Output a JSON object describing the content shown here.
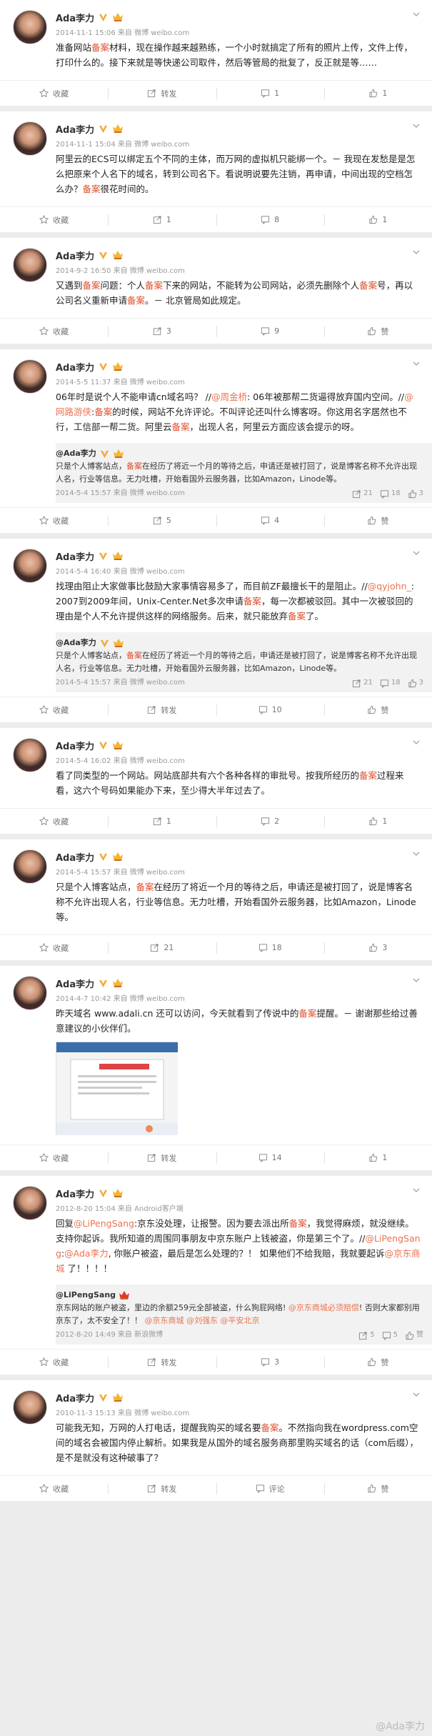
{
  "user": {
    "name": "Ada李力"
  },
  "watermark": "@Ada李力",
  "posts": [
    {
      "meta": "2014-11-1 15:06 来自 微博 weibo.com",
      "segments": [
        {
          "t": "准备网站"
        },
        {
          "t": "备案",
          "c": "kw"
        },
        {
          "t": "材料，现在操作越来越熟练，一个小时就搞定了所有的照片上传，文件上传，打印什么的。接下来就是等快递公司取件，然后等管局的批复了，反正就是等……"
        }
      ],
      "actions": [
        "收藏",
        "转发",
        "1",
        "1"
      ]
    },
    {
      "meta": "2014-11-1 15:04 来自 微博 weibo.com",
      "segments": [
        {
          "t": "阿里云的ECS可以绑定五个不同的主体，而万网的虚拟机只能绑一个。－ 我现在发愁是是怎么把原来个人名下的域名，转到公司名下。看说明说要先注销，再申请，中间出现的空档怎么办？"
        },
        {
          "t": "备案",
          "c": "kw"
        },
        {
          "t": "很花时间的。"
        }
      ],
      "actions": [
        "收藏",
        "1",
        "8",
        "1"
      ]
    },
    {
      "meta": "2014-9-2 16:50 来自 微博 weibo.com",
      "segments": [
        {
          "t": "又遇到"
        },
        {
          "t": "备案",
          "c": "kw"
        },
        {
          "t": "问题：个人"
        },
        {
          "t": "备案",
          "c": "kw"
        },
        {
          "t": "下来的网站，不能转为公司网站，必须先删除个人"
        },
        {
          "t": "备案",
          "c": "kw"
        },
        {
          "t": "号，再以公司名义重新申请"
        },
        {
          "t": "备案",
          "c": "kw"
        },
        {
          "t": "。－ 北京管局如此规定。"
        }
      ],
      "actions": [
        "收藏",
        "3",
        "9",
        "赞"
      ]
    },
    {
      "meta": "2014-5-5 11:37 来自 微博 weibo.com",
      "segments": [
        {
          "t": "06年时是说个人不能申请cn域名吗？ //"
        },
        {
          "t": "@周金桥",
          "c": "mention"
        },
        {
          "t": ": 06年被那帮二货逼得放弃国内空间。//"
        },
        {
          "t": "@网路游侠",
          "c": "mention"
        },
        {
          "t": ":"
        },
        {
          "t": "备案",
          "c": "kw"
        },
        {
          "t": "的时候，网站不允许评论。不叫评论还叫什么博客呀。你这用名字居然也不行，工信部一帮二货。阿里云"
        },
        {
          "t": "备案",
          "c": "kw"
        },
        {
          "t": "，出现人名，阿里云方面应该会提示的呀。"
        }
      ],
      "quote": {
        "name": "@Ada李力",
        "segments": [
          {
            "t": "只是个人博客站点，"
          },
          {
            "t": "备案",
            "c": "kw"
          },
          {
            "t": "在经历了将近一个月的等待之后，申请还是被打回了，说是博客名称不允许出现人名，行业等信息。无力吐槽，开始看国外云服务器，比如Amazon，Linode等。"
          }
        ],
        "time": "2014-5-4 15:57 来自 微博 weibo.com",
        "stats": [
          "21",
          "18",
          "3"
        ]
      },
      "actions": [
        "收藏",
        "5",
        "4",
        "赞"
      ]
    },
    {
      "meta": "2014-5-4 16:40 来自 微博 weibo.com",
      "segments": [
        {
          "t": "找理由阻止大家做事比鼓励大家事情容易多了，而目前ZF最擅长干的是阻止。//"
        },
        {
          "t": "@qyjohn_",
          "c": "mention"
        },
        {
          "t": ": 2007到2009年间，Unix-Center.Net多次申请"
        },
        {
          "t": "备案",
          "c": "kw"
        },
        {
          "t": "，每一次都被驳回。其中一次被驳回的理由是个人不允许提供这样的网络服务。后来，就只能放弃"
        },
        {
          "t": "备案",
          "c": "kw"
        },
        {
          "t": "了。"
        }
      ],
      "quote": {
        "name": "@Ada李力",
        "segments": [
          {
            "t": "只是个人博客站点，"
          },
          {
            "t": "备案",
            "c": "kw"
          },
          {
            "t": "在经历了将近一个月的等待之后，申请还是被打回了，说是博客名称不允许出现人名，行业等信息。无力吐槽，开始看国外云服务器，比如Amazon，Linode等。"
          }
        ],
        "time": "2014-5-4 15:57 来自 微博 weibo.com",
        "stats": [
          "21",
          "18",
          "3"
        ]
      },
      "actions": [
        "收藏",
        "转发",
        "10",
        "赞"
      ]
    },
    {
      "meta": "2014-5-4 16:02 来自 微博 weibo.com",
      "segments": [
        {
          "t": "看了同类型的一个网站。网站底部共有六个各种各样的审批号。按我所经历的"
        },
        {
          "t": "备案",
          "c": "kw"
        },
        {
          "t": "过程来看，这六个号码如果能办下来，至少得大半年过去了。"
        }
      ],
      "actions": [
        "收藏",
        "1",
        "2",
        "1"
      ]
    },
    {
      "meta": "2014-5-4 15:57 来自 微博 weibo.com",
      "segments": [
        {
          "t": "只是个人博客站点，"
        },
        {
          "t": "备案",
          "c": "kw"
        },
        {
          "t": "在经历了将近一个月的等待之后，申请还是被打回了，说是博客名称不允许出现人名，行业等信息。无力吐槽，开始看国外云服务器，比如Amazon，Linode等。"
        }
      ],
      "actions": [
        "收藏",
        "21",
        "18",
        "3"
      ]
    },
    {
      "meta": "2014-4-7 10:42 来自 微博 weibo.com",
      "segments": [
        {
          "t": "昨天域名 www.adali.cn 还可以访问，今天就看到了传说中的"
        },
        {
          "t": "备案",
          "c": "kw"
        },
        {
          "t": "提醒。－ 谢谢那些给过善意建议的小伙伴们。"
        }
      ],
      "image": true,
      "actions": [
        "收藏",
        "转发",
        "14",
        "1"
      ]
    },
    {
      "meta": "2012-8-20 15:04 来自 Android客户端",
      "segments": [
        {
          "t": "回复"
        },
        {
          "t": "@LiPengSang",
          "c": "mention"
        },
        {
          "t": ":京东没处理，让报警。因为要去派出所"
        },
        {
          "t": "备案",
          "c": "kw"
        },
        {
          "t": "，我觉得麻烦，就没继续。支持你起诉。我所知道的周围同事朋友中京东账户上钱被盗，你是第三个了。//"
        },
        {
          "t": "@LiPengSang",
          "c": "mention"
        },
        {
          "t": ":"
        },
        {
          "t": "@Ada李力",
          "c": "mention"
        },
        {
          "t": ", 你账户被盗，最后是怎么处理的？！ 如果他们不给我赔，我就要起诉"
        },
        {
          "t": "@京东商城",
          "c": "mention"
        },
        {
          "t": " 了！！！！"
        }
      ],
      "quote": {
        "name": "@LiPengSang",
        "crown_red": true,
        "segments": [
          {
            "t": "京东网站的账户被盗，里边的余额259元全部被盗，什么狗屁网络! "
          },
          {
            "t": "@京东商城必须赔偿",
            "c": "mention"
          },
          {
            "t": "! 否则大家都别用京东了，太不安全了！！ "
          },
          {
            "t": "@京东商城",
            "c": "mention"
          },
          {
            "t": " "
          },
          {
            "t": "@刘强东",
            "c": "mention"
          },
          {
            "t": " "
          },
          {
            "t": "@平安北京",
            "c": "mention"
          }
        ],
        "time": "2012-8-20 14:49 来自 新浪微博",
        "stats": [
          "5",
          "5",
          "赞"
        ]
      },
      "actions": [
        "收藏",
        "转发",
        "3",
        "赞"
      ]
    },
    {
      "meta": "2010-11-3 15:13 来自 微博 weibo.com",
      "segments": [
        {
          "t": "可能我无知，万网的人打电话，提醒我购买的域名要"
        },
        {
          "t": "备案",
          "c": "kw"
        },
        {
          "t": "。不然指向我在wordpress.com空间的域名会被国内停止解析。如果我是从国外的域名服务商那里购买域名的话（com后缀），是不是就没有这种破事了？"
        }
      ],
      "actions": [
        "收藏",
        "转发",
        "评论",
        "赞"
      ]
    }
  ]
}
